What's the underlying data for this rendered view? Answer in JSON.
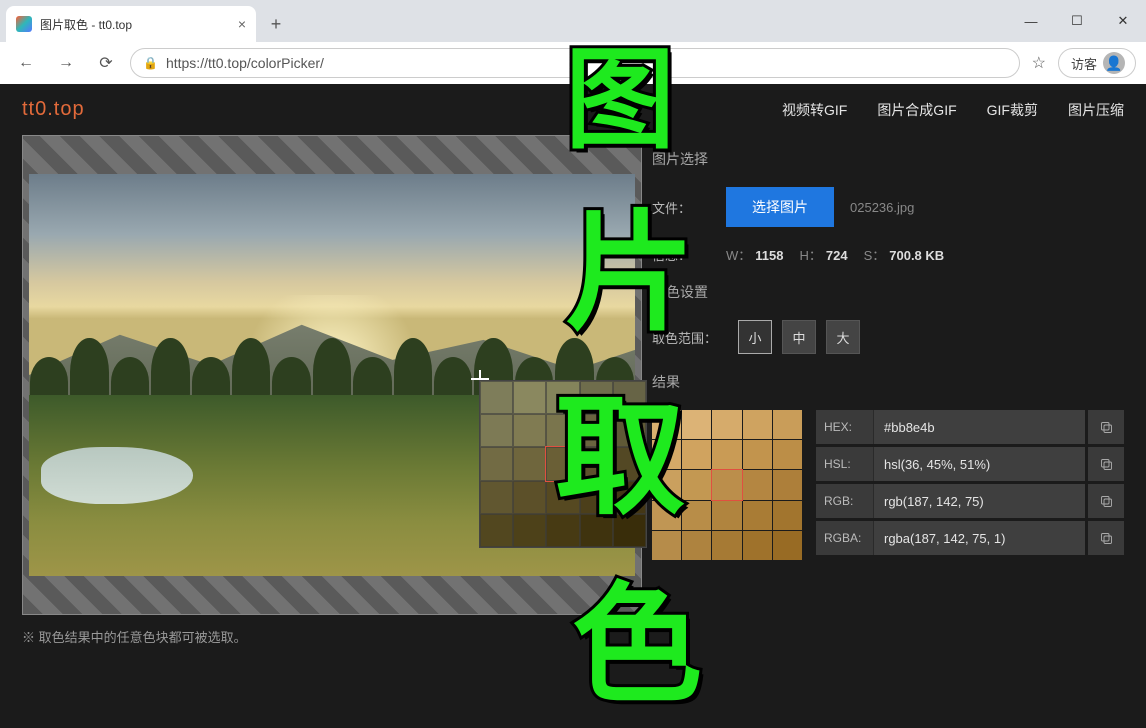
{
  "browser": {
    "tab_title": "图片取色 - tt0.top",
    "url": "https://tt0.top/colorPicker/",
    "guest_label": "访客"
  },
  "header": {
    "logo": "tt0.top",
    "nav": [
      "视频转GIF",
      "图片合成GIF",
      "GIF裁剪",
      "图片压缩"
    ]
  },
  "panel": {
    "section_image_select": "图片选择",
    "file_label": "文件：",
    "select_button": "选择图片",
    "filename": "025236.jpg",
    "info_label": "信息：",
    "info_w_prefix": "W：",
    "info_w": "1158",
    "info_h_prefix": "H：",
    "info_h": "724",
    "info_s_prefix": "S：",
    "info_s": "700.8 KB",
    "section_pick_settings": "取色设置",
    "range_label": "取色范围：",
    "range_options": [
      "小",
      "中",
      "大"
    ],
    "section_result": "结果"
  },
  "results": {
    "rows": [
      {
        "label": "HEX:",
        "value": "#bb8e4b"
      },
      {
        "label": "HSL:",
        "value": "hsl(36, 45%, 51%)"
      },
      {
        "label": "RGB:",
        "value": "rgb(187, 142, 75)"
      },
      {
        "label": "RGBA:",
        "value": "rgba(187, 142, 75, 1)"
      }
    ]
  },
  "footnote": "※ 取色结果中的任意色块都可被选取。",
  "zoom_colors": [
    "#7e7d5a",
    "#8a885f",
    "#84845b",
    "#6f6d4c",
    "#676446",
    "#7d7a55",
    "#807b52",
    "#7a754d",
    "#6a643f",
    "#5f5936",
    "#726b44",
    "#6f663d",
    "#6a5f36",
    "#5d522c",
    "#534824",
    "#615730",
    "#5c5029",
    "#564921",
    "#4c3f1a",
    "#443715",
    "#52471f",
    "#4d4119",
    "#473a13",
    "#3f330e",
    "#392d0a"
  ],
  "result_colors": [
    "#d9b070",
    "#dcb376",
    "#d6ab6b",
    "#cfa360",
    "#c99d59",
    "#d4a968",
    "#d0a35f",
    "#c99b55",
    "#c2944d",
    "#bc8e47",
    "#caa05e",
    "#c39852",
    "#bb8e4b",
    "#b48641",
    "#ad7f3a",
    "#c09654",
    "#b88d48",
    "#b0843e",
    "#a97c35",
    "#a2752e",
    "#b68c4a",
    "#ae833f",
    "#a67a34",
    "#9f722b",
    "#986b24"
  ],
  "watermarks": [
    "图",
    "片",
    "取",
    "色"
  ]
}
